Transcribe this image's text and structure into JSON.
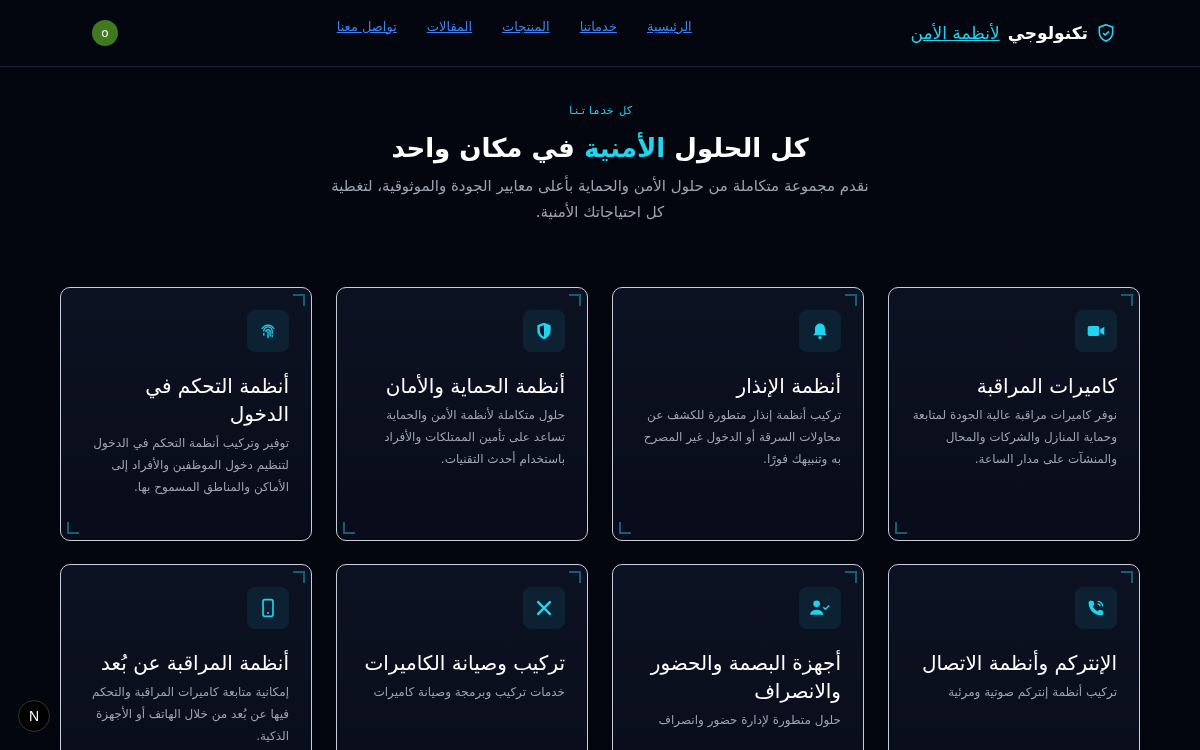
{
  "header": {
    "brand": {
      "name": "تكنولوجي",
      "tagline": "لأنظمة الأمن"
    },
    "nav": [
      {
        "label": "الرئيسية"
      },
      {
        "label": "خدماتنا"
      },
      {
        "label": "المنتجات"
      },
      {
        "label": "المقالات"
      },
      {
        "label": "تواصل معنا"
      }
    ],
    "avatar": "o"
  },
  "section": {
    "eyebrow": "كل خدماتنا",
    "title": "كل الحلول **الأمنية** في مكان واحد",
    "subtitle": "نقدم مجموعة متكاملة من حلول الأمن والحماية بأعلى معايير الجودة والموثوقية، لتغطية كل احتياجاتك الأمنية."
  },
  "services": [
    {
      "kind": "camera",
      "title": "كاميرات المراقبة",
      "description": "نوفر كاميرات مراقبة عالية الجودة لمتابعة وحماية المنازل والشركات والمحال والمنشآت على مدار الساعة."
    },
    {
      "kind": "bell",
      "title": "أنظمة الإنذار",
      "description": "تركيب أنظمة إنذار متطورة للكشف عن محاولات السرقة أو الدخول غير المصرح به وتنبيهك فورًا."
    },
    {
      "kind": "shield",
      "title": "أنظمة الحماية والأمان",
      "description": "حلول متكاملة لأنظمة الأمن والحماية تساعد على تأمين الممتلكات والأفراد باستخدام أحدث التقنيات."
    },
    {
      "kind": "fingerprint",
      "title": "أنظمة التحكم في الدخول",
      "description": "توفير وتركيب أنظمة التحكم في الدخول لتنظيم دخول الموظفين والأفراد إلى الأماكن والمناطق المسموح بها."
    },
    {
      "kind": "phone",
      "title": "الإنتركم وأنظمة الاتصال",
      "description": "تركيب أنظمة إنتركم صوتية ومرئية"
    },
    {
      "kind": "user-check",
      "title": "أجهزة البصمة والحضور والانصراف",
      "description": "حلول متطورة لإدارة حضور وانصراف"
    },
    {
      "kind": "tools",
      "title": "تركيب وصيانة الكاميرات",
      "description": "خدمات تركيب وبرمجة وصيانة كاميرات"
    },
    {
      "kind": "mobile",
      "title": "أنظمة المراقبة عن بُعد",
      "description": "إمكانية متابعة كاميرات المراقبة والتحكم فيها عن بُعد من خلال الهاتف أو الأجهزة الذكية."
    }
  ],
  "dev_badge": "N"
}
